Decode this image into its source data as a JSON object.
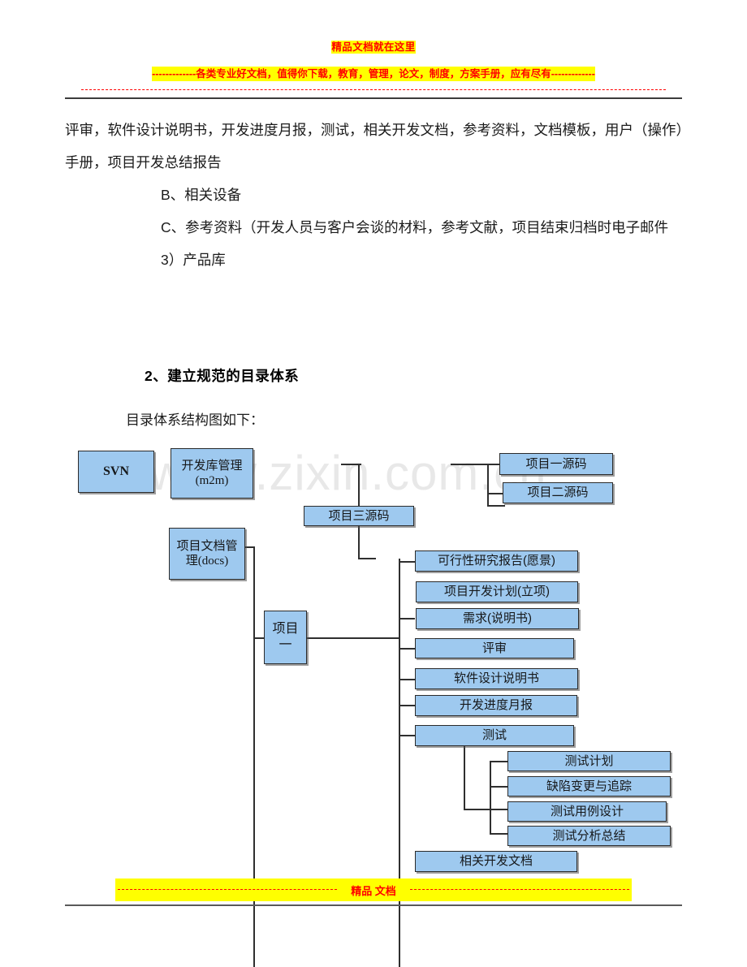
{
  "header": {
    "title_line": "精品文档就在这里",
    "subtitle_prefix": "-------------",
    "subtitle": "各类专业好文档，值得你下载，教育，管理，论文，制度，方案手册，应有尽有",
    "subtitle_suffix": "-------------"
  },
  "watermark": {
    "text": "www.zixin.com.cn"
  },
  "body": {
    "paragraph_1": "评审，软件设计说明书，开发进度月报，测试，相关开发文档，参考资料，文档模板，用户（操作）手册，项目开发总结报告",
    "item_b": "B、相关设备",
    "item_c": "C、参考资料（开发人员与客户会谈的材料，参考文献，项目结束归档时电子邮件",
    "item_3": "3）产品库",
    "section_heading": "2、建立规范的目录体系",
    "section_subtext": "目录体系结构图如下："
  },
  "diagram": {
    "nodes": {
      "svn": "SVN",
      "dev_repo": "开发库管理",
      "dev_repo_sub": "(m2m)",
      "proj_docs": "项目文档管",
      "proj_docs_sub": "理(docs)",
      "proj3_src": "项目三源码",
      "proj1_src": "项目一源码",
      "proj2_src": "项目二源码",
      "project1_l1": "项目",
      "project1_l2": "一",
      "feasibility": "可行性研究报告(愿景)",
      "dev_plan": "项目开发计划(立项)",
      "requirement": "需求(说明书)",
      "review": "评审",
      "design_spec": "软件设计说明书",
      "monthly_report": "开发进度月报",
      "test": "测试",
      "test_plan": "测试计划",
      "defect_track": "缺陷变更与追踪",
      "test_case": "测试用例设计",
      "test_summary": "测试分析总结",
      "related_docs": "相关开发文档"
    }
  },
  "footer": {
    "text": "精品  文档",
    "dash_prefix": "-----------------------",
    "dash_suffix": "-----------------------"
  },
  "colors": {
    "node_fill": "#9ec9ef",
    "node_border": "#2b2b2b",
    "highlight": "#ffff00",
    "accent_red": "#ff0000"
  }
}
